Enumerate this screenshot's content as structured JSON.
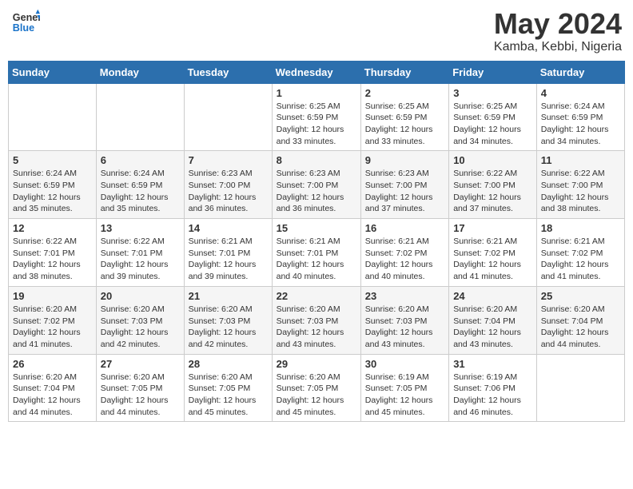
{
  "header": {
    "logo_line1": "General",
    "logo_line2": "Blue",
    "month_year": "May 2024",
    "location": "Kamba, Kebbi, Nigeria"
  },
  "weekdays": [
    "Sunday",
    "Monday",
    "Tuesday",
    "Wednesday",
    "Thursday",
    "Friday",
    "Saturday"
  ],
  "weeks": [
    [
      {
        "day": "",
        "info": ""
      },
      {
        "day": "",
        "info": ""
      },
      {
        "day": "",
        "info": ""
      },
      {
        "day": "1",
        "info": "Sunrise: 6:25 AM\nSunset: 6:59 PM\nDaylight: 12 hours\nand 33 minutes."
      },
      {
        "day": "2",
        "info": "Sunrise: 6:25 AM\nSunset: 6:59 PM\nDaylight: 12 hours\nand 33 minutes."
      },
      {
        "day": "3",
        "info": "Sunrise: 6:25 AM\nSunset: 6:59 PM\nDaylight: 12 hours\nand 34 minutes."
      },
      {
        "day": "4",
        "info": "Sunrise: 6:24 AM\nSunset: 6:59 PM\nDaylight: 12 hours\nand 34 minutes."
      }
    ],
    [
      {
        "day": "5",
        "info": "Sunrise: 6:24 AM\nSunset: 6:59 PM\nDaylight: 12 hours\nand 35 minutes."
      },
      {
        "day": "6",
        "info": "Sunrise: 6:24 AM\nSunset: 6:59 PM\nDaylight: 12 hours\nand 35 minutes."
      },
      {
        "day": "7",
        "info": "Sunrise: 6:23 AM\nSunset: 7:00 PM\nDaylight: 12 hours\nand 36 minutes."
      },
      {
        "day": "8",
        "info": "Sunrise: 6:23 AM\nSunset: 7:00 PM\nDaylight: 12 hours\nand 36 minutes."
      },
      {
        "day": "9",
        "info": "Sunrise: 6:23 AM\nSunset: 7:00 PM\nDaylight: 12 hours\nand 37 minutes."
      },
      {
        "day": "10",
        "info": "Sunrise: 6:22 AM\nSunset: 7:00 PM\nDaylight: 12 hours\nand 37 minutes."
      },
      {
        "day": "11",
        "info": "Sunrise: 6:22 AM\nSunset: 7:00 PM\nDaylight: 12 hours\nand 38 minutes."
      }
    ],
    [
      {
        "day": "12",
        "info": "Sunrise: 6:22 AM\nSunset: 7:01 PM\nDaylight: 12 hours\nand 38 minutes."
      },
      {
        "day": "13",
        "info": "Sunrise: 6:22 AM\nSunset: 7:01 PM\nDaylight: 12 hours\nand 39 minutes."
      },
      {
        "day": "14",
        "info": "Sunrise: 6:21 AM\nSunset: 7:01 PM\nDaylight: 12 hours\nand 39 minutes."
      },
      {
        "day": "15",
        "info": "Sunrise: 6:21 AM\nSunset: 7:01 PM\nDaylight: 12 hours\nand 40 minutes."
      },
      {
        "day": "16",
        "info": "Sunrise: 6:21 AM\nSunset: 7:02 PM\nDaylight: 12 hours\nand 40 minutes."
      },
      {
        "day": "17",
        "info": "Sunrise: 6:21 AM\nSunset: 7:02 PM\nDaylight: 12 hours\nand 41 minutes."
      },
      {
        "day": "18",
        "info": "Sunrise: 6:21 AM\nSunset: 7:02 PM\nDaylight: 12 hours\nand 41 minutes."
      }
    ],
    [
      {
        "day": "19",
        "info": "Sunrise: 6:20 AM\nSunset: 7:02 PM\nDaylight: 12 hours\nand 41 minutes."
      },
      {
        "day": "20",
        "info": "Sunrise: 6:20 AM\nSunset: 7:03 PM\nDaylight: 12 hours\nand 42 minutes."
      },
      {
        "day": "21",
        "info": "Sunrise: 6:20 AM\nSunset: 7:03 PM\nDaylight: 12 hours\nand 42 minutes."
      },
      {
        "day": "22",
        "info": "Sunrise: 6:20 AM\nSunset: 7:03 PM\nDaylight: 12 hours\nand 43 minutes."
      },
      {
        "day": "23",
        "info": "Sunrise: 6:20 AM\nSunset: 7:03 PM\nDaylight: 12 hours\nand 43 minutes."
      },
      {
        "day": "24",
        "info": "Sunrise: 6:20 AM\nSunset: 7:04 PM\nDaylight: 12 hours\nand 43 minutes."
      },
      {
        "day": "25",
        "info": "Sunrise: 6:20 AM\nSunset: 7:04 PM\nDaylight: 12 hours\nand 44 minutes."
      }
    ],
    [
      {
        "day": "26",
        "info": "Sunrise: 6:20 AM\nSunset: 7:04 PM\nDaylight: 12 hours\nand 44 minutes."
      },
      {
        "day": "27",
        "info": "Sunrise: 6:20 AM\nSunset: 7:05 PM\nDaylight: 12 hours\nand 44 minutes."
      },
      {
        "day": "28",
        "info": "Sunrise: 6:20 AM\nSunset: 7:05 PM\nDaylight: 12 hours\nand 45 minutes."
      },
      {
        "day": "29",
        "info": "Sunrise: 6:20 AM\nSunset: 7:05 PM\nDaylight: 12 hours\nand 45 minutes."
      },
      {
        "day": "30",
        "info": "Sunrise: 6:19 AM\nSunset: 7:05 PM\nDaylight: 12 hours\nand 45 minutes."
      },
      {
        "day": "31",
        "info": "Sunrise: 6:19 AM\nSunset: 7:06 PM\nDaylight: 12 hours\nand 46 minutes."
      },
      {
        "day": "",
        "info": ""
      }
    ]
  ]
}
